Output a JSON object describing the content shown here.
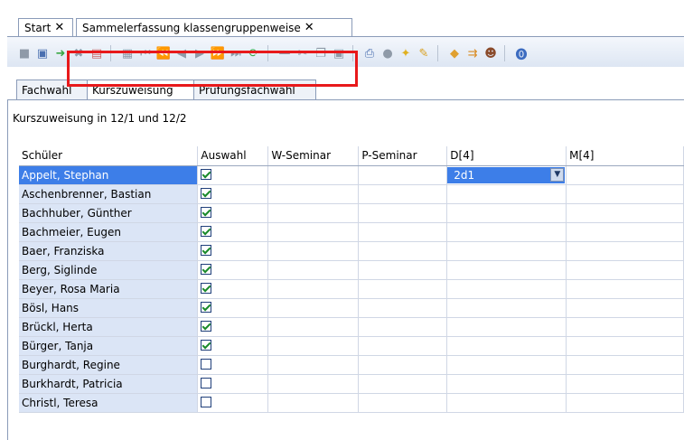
{
  "document_tabs": [
    {
      "label": "Start",
      "close": "✕"
    },
    {
      "label": "Sammelerfassung klassengruppenweise",
      "close": "✕"
    }
  ],
  "subtabs": [
    "Fachwahl",
    "Kurszuweisung",
    "Prüfungsfachwahl"
  ],
  "caption": "Kurszuweisung in 12/1 und 12/2",
  "columns": [
    "Schüler",
    "Auswahl",
    "W-Seminar",
    "P-Seminar",
    "D[4]",
    "M[4]"
  ],
  "rows": [
    {
      "name": "Appelt, Stephan",
      "auswahl": true,
      "d4": "2d1"
    },
    {
      "name": "Aschenbrenner, Bastian",
      "auswahl": true,
      "d4": ""
    },
    {
      "name": "Bachhuber, Günther",
      "auswahl": true,
      "d4": ""
    },
    {
      "name": "Bachmeier, Eugen",
      "auswahl": true,
      "d4": ""
    },
    {
      "name": "Baer, Franziska",
      "auswahl": true,
      "d4": ""
    },
    {
      "name": "Berg, Siglinde",
      "auswahl": true,
      "d4": ""
    },
    {
      "name": "Beyer, Rosa Maria",
      "auswahl": true,
      "d4": ""
    },
    {
      "name": "Bösl, Hans",
      "auswahl": true,
      "d4": ""
    },
    {
      "name": "Brückl, Herta",
      "auswahl": true,
      "d4": ""
    },
    {
      "name": "Bürger, Tanja",
      "auswahl": true,
      "d4": ""
    },
    {
      "name": "Burghardt, Regine",
      "auswahl": false,
      "d4": ""
    },
    {
      "name": "Burkhardt, Patricia",
      "auswahl": false,
      "d4": ""
    },
    {
      "name": "Christl, Teresa",
      "auswahl": false,
      "d4": ""
    }
  ],
  "selected_row": 0,
  "colors": {
    "selection": "#3d7ee8",
    "name_cell": "#dbe5f6",
    "highlight_box": "#e8191b"
  }
}
